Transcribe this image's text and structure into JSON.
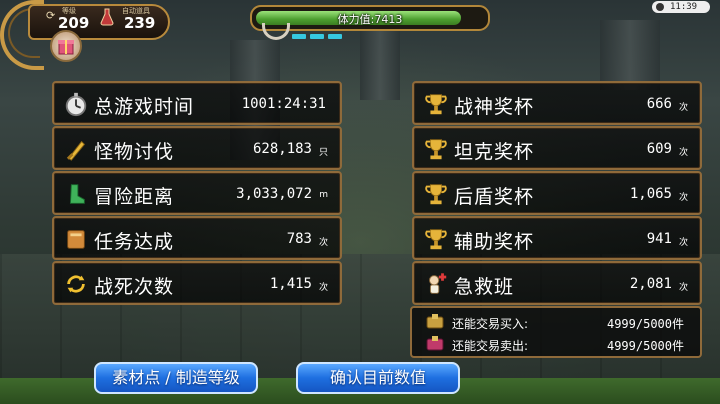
{
  "player": {
    "level_caption": "等级",
    "level": "209",
    "auto_caption": "自动道具",
    "auto_value": "239"
  },
  "stamina": {
    "label": "体力值:7413",
    "fill_fraction": 0.9
  },
  "clock": {
    "time": "11:39"
  },
  "left_stats": [
    {
      "icon": "stopwatch-icon",
      "label": "总游戏时间",
      "value": "1001:24:31",
      "unit": ""
    },
    {
      "icon": "sword-icon",
      "label": "怪物讨伐",
      "value": "628,183",
      "unit": "只"
    },
    {
      "icon": "boots-icon",
      "label": "冒险距离",
      "value": "3,033,072",
      "unit": "m"
    },
    {
      "icon": "book-icon",
      "label": "任务达成",
      "value": "783",
      "unit": "次"
    },
    {
      "icon": "revive-icon",
      "label": "战死次数",
      "value": "1,415",
      "unit": "次"
    }
  ],
  "right_stats": [
    {
      "icon": "trophy-icon",
      "label": "战神奖杯",
      "value": "666",
      "unit": "次"
    },
    {
      "icon": "trophy-icon",
      "label": "坦克奖杯",
      "value": "609",
      "unit": "次"
    },
    {
      "icon": "trophy-icon",
      "label": "后盾奖杯",
      "value": "1,065",
      "unit": "次"
    },
    {
      "icon": "trophy-icon",
      "label": "辅助奖杯",
      "value": "941",
      "unit": "次"
    },
    {
      "icon": "first-aid-icon",
      "label": "急救班",
      "value": "2,081",
      "unit": "次"
    }
  ],
  "trade": [
    {
      "icon": "trade-buy-icon",
      "label": "还能交易买入:",
      "value": "4999/5000件"
    },
    {
      "icon": "trade-sell-icon",
      "label": "还能交易卖出:",
      "value": "4999/5000件"
    }
  ],
  "buttons": {
    "material_level": "素材点 / 制造等级",
    "confirm_values": "确认目前数值"
  },
  "colors": {
    "panel_border": "#8f6a3a",
    "button_blue": "#1e6fe0",
    "stamina_green": "#4c9e2f"
  }
}
